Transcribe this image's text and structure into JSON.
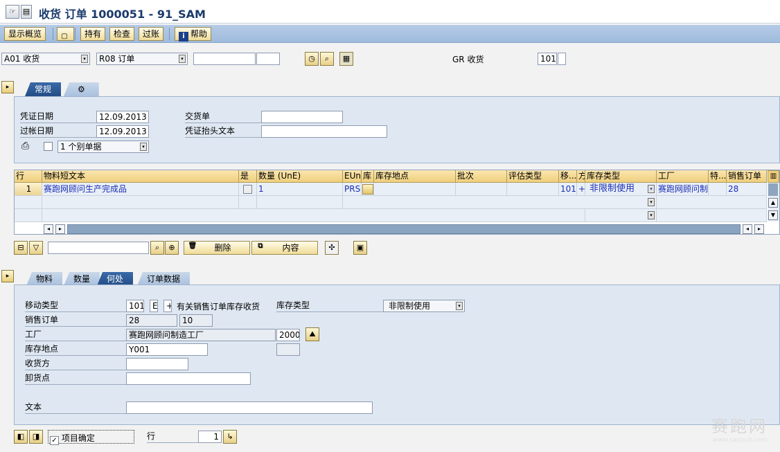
{
  "title": "收货 订单 1000051 - 91_SAM",
  "toolbar": {
    "overview": "显示概览",
    "hold": "持有",
    "check": "检查",
    "post": "过账",
    "help": "帮助"
  },
  "header": {
    "action": "A01 收货",
    "reference": "R08 订单",
    "gr_label": "GR 收货",
    "movement_type": "101"
  },
  "tabs_top": [
    "常规"
  ],
  "general": {
    "doc_date_label": "凭证日期",
    "doc_date": "12.09.2013",
    "post_date_label": "过帐日期",
    "post_date": "12.09.2013",
    "slip_option": "1 个别单据",
    "delivery_note_label": "交货单",
    "header_text_label": "凭证抬头文本"
  },
  "table": {
    "columns": [
      "行",
      "物料短文本",
      "是",
      "数量 (UnE)",
      "EUn",
      "库",
      "库存地点",
      "批次",
      "评估类型",
      "移...",
      "方",
      "库存类型",
      "工厂",
      "特...",
      "销售订单"
    ],
    "rows": [
      {
        "line": "1",
        "text": "赛跑网顾问生产完成品",
        "qty": "1",
        "unit": "PRS",
        "mvt": "101",
        "dir": "+",
        "stock_type": "非限制使用",
        "plant": "赛跑网顾问制适",
        "so": "28"
      }
    ]
  },
  "table_actions": {
    "delete": "删除",
    "content": "内容"
  },
  "tabs_bottom": [
    "物料",
    "数量",
    "何处",
    "订单数据"
  ],
  "where": {
    "mvt_label": "移动类型",
    "mvt": "101",
    "mvt_e": "E",
    "mvt_sign": "+",
    "mvt_desc": "有关销售订单库存收货",
    "stock_type_label": "库存类型",
    "stock_type": "非限制使用",
    "so_label": "销售订单",
    "so": "28",
    "so_item": "10",
    "plant_label": "工厂",
    "plant_name": "赛跑网顾问制造工厂",
    "plant_code": "2000",
    "sloc_label": "库存地点",
    "sloc": "Y001",
    "recipient_label": "收货方",
    "unload_label": "卸货点",
    "text_label": "文本"
  },
  "footer": {
    "item_ok": "项目确定",
    "line_label": "行",
    "line_value": "1"
  },
  "watermark": {
    "text": "赛跑网",
    "url": "www.sappub.com"
  }
}
